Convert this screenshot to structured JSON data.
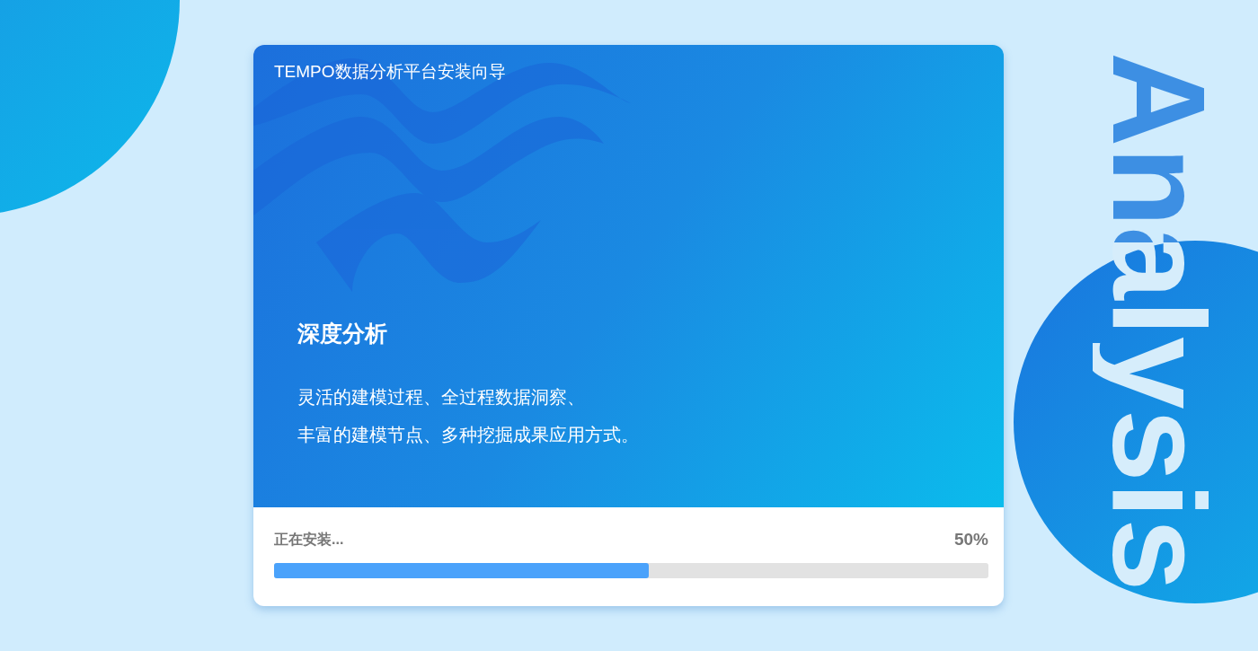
{
  "window": {
    "title": "TEMPO数据分析平台安装向导"
  },
  "banner": {
    "heading": "深度分析",
    "description": [
      "灵活的建模过程、全过程数据洞察、",
      "丰富的建模节点、多种挖掘成果应用方式。"
    ]
  },
  "progress": {
    "label": "正在安装...",
    "reading": "50%",
    "level": 0.525
  },
  "side_text": "Analysis"
}
